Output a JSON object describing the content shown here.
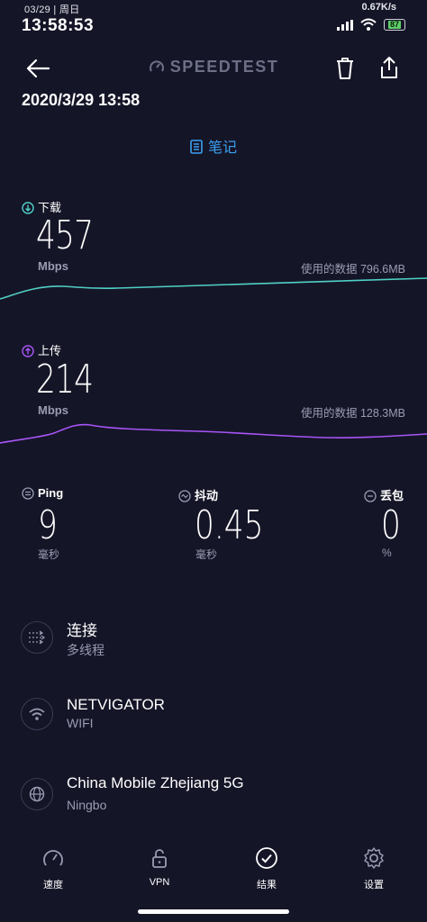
{
  "status_bar": {
    "date": "03/29 | 周日",
    "time": "13:58:53",
    "speed": "0.67K/s",
    "battery": "87"
  },
  "header": {
    "title": "SPEEDTEST",
    "timestamp": "2020/3/29 13:58",
    "notes_label": "笔记"
  },
  "download": {
    "label": "下载",
    "value": "457",
    "unit": "Mbps",
    "data_used": "使用的数据 796.6MB"
  },
  "upload": {
    "label": "上传",
    "value": "214",
    "unit": "Mbps",
    "data_used": "使用的数据 128.3MB"
  },
  "stats": {
    "ping": {
      "label": "Ping",
      "value": "9",
      "unit": "毫秒"
    },
    "jitter": {
      "label": "抖动",
      "value": "0.45",
      "unit": "毫秒"
    },
    "loss": {
      "label": "丢包",
      "value": "0",
      "unit": "%"
    }
  },
  "info": {
    "connection": {
      "title": "连接",
      "sub": "多线程"
    },
    "network": {
      "title": "NETVIGATOR",
      "sub": "WIFI"
    },
    "server": {
      "title": "China Mobile Zhejiang 5G",
      "sub": "Ningbo"
    }
  },
  "nav": {
    "speed": "速度",
    "vpn": "VPN",
    "results": "结果",
    "settings": "设置"
  },
  "colors": {
    "background": "#151528",
    "download": "#4fd1c5",
    "upload": "#a855f7",
    "accent": "#3aa0ef"
  }
}
